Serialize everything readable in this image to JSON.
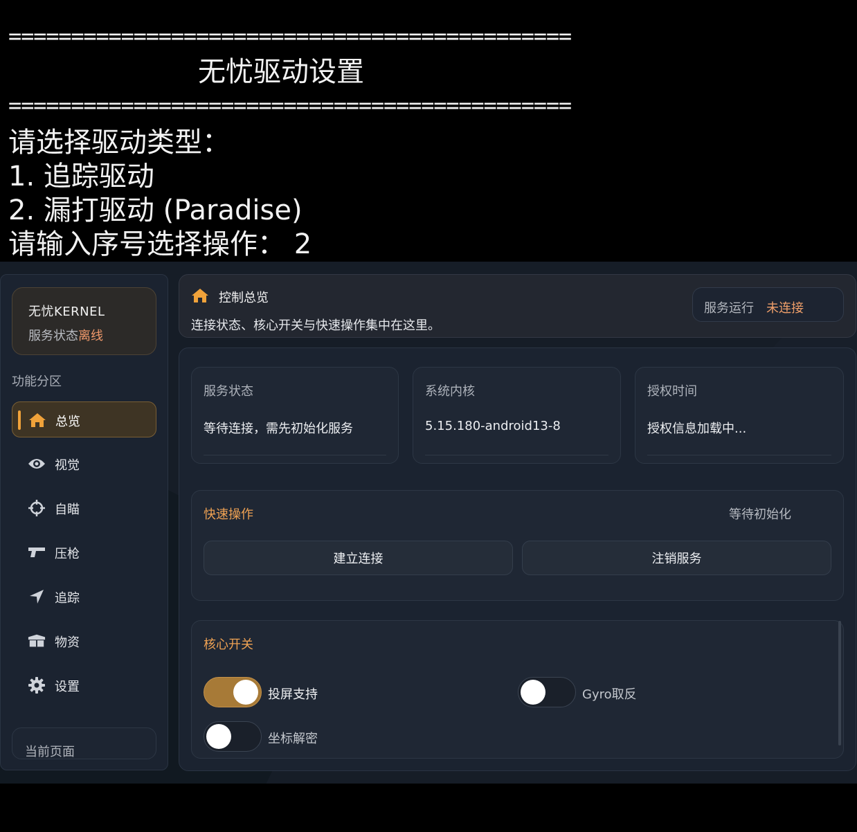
{
  "terminal": {
    "separator": "=============================================",
    "title": "无忧驱动设置",
    "prompt": "请选择驱动类型：",
    "option1": "1. 追踪驱动",
    "option2": "2. 漏打驱动 (Paradise)",
    "input_prompt": "请输入序号选择操作： 2"
  },
  "sidebar": {
    "brand_name": "无忧KERNEL",
    "status_label": "服务状态",
    "status_value": "离线",
    "section_label": "功能分区",
    "items": [
      {
        "label": "总览",
        "icon": "home-icon",
        "active": true
      },
      {
        "label": "视觉",
        "icon": "eye-icon"
      },
      {
        "label": "自瞄",
        "icon": "crosshair-icon"
      },
      {
        "label": "压枪",
        "icon": "gun-icon"
      },
      {
        "label": "追踪",
        "icon": "location-arrow-icon"
      },
      {
        "label": "物资",
        "icon": "box-icon"
      },
      {
        "label": "设置",
        "icon": "gear-icon"
      }
    ],
    "current_page_label": "当前页面"
  },
  "header": {
    "title": "控制总览",
    "subtitle": "连接状态、核心开关与快速操作集中在这里。",
    "service_label": "服务运行",
    "service_value": "未连接"
  },
  "stats": [
    {
      "label": "服务状态",
      "value": "等待连接，需先初始化服务"
    },
    {
      "label": "系统内核",
      "value": "5.15.180-android13-8"
    },
    {
      "label": "授权时间",
      "value": "授权信息加载中..."
    }
  ],
  "quick": {
    "title": "快速操作",
    "status": "等待初始化",
    "connect_label": "建立连接",
    "logout_label": "注销服务"
  },
  "core": {
    "title": "核心开关",
    "toggles": [
      {
        "label": "投屏支持",
        "on": true
      },
      {
        "label": "Gyro取反",
        "on": false
      },
      {
        "label": "坐标解密",
        "on": false
      }
    ]
  },
  "colors": {
    "accent": "#efa253",
    "warning": "#ef9f6a",
    "toggle_on": "#a77a37",
    "background": "#161d27"
  }
}
